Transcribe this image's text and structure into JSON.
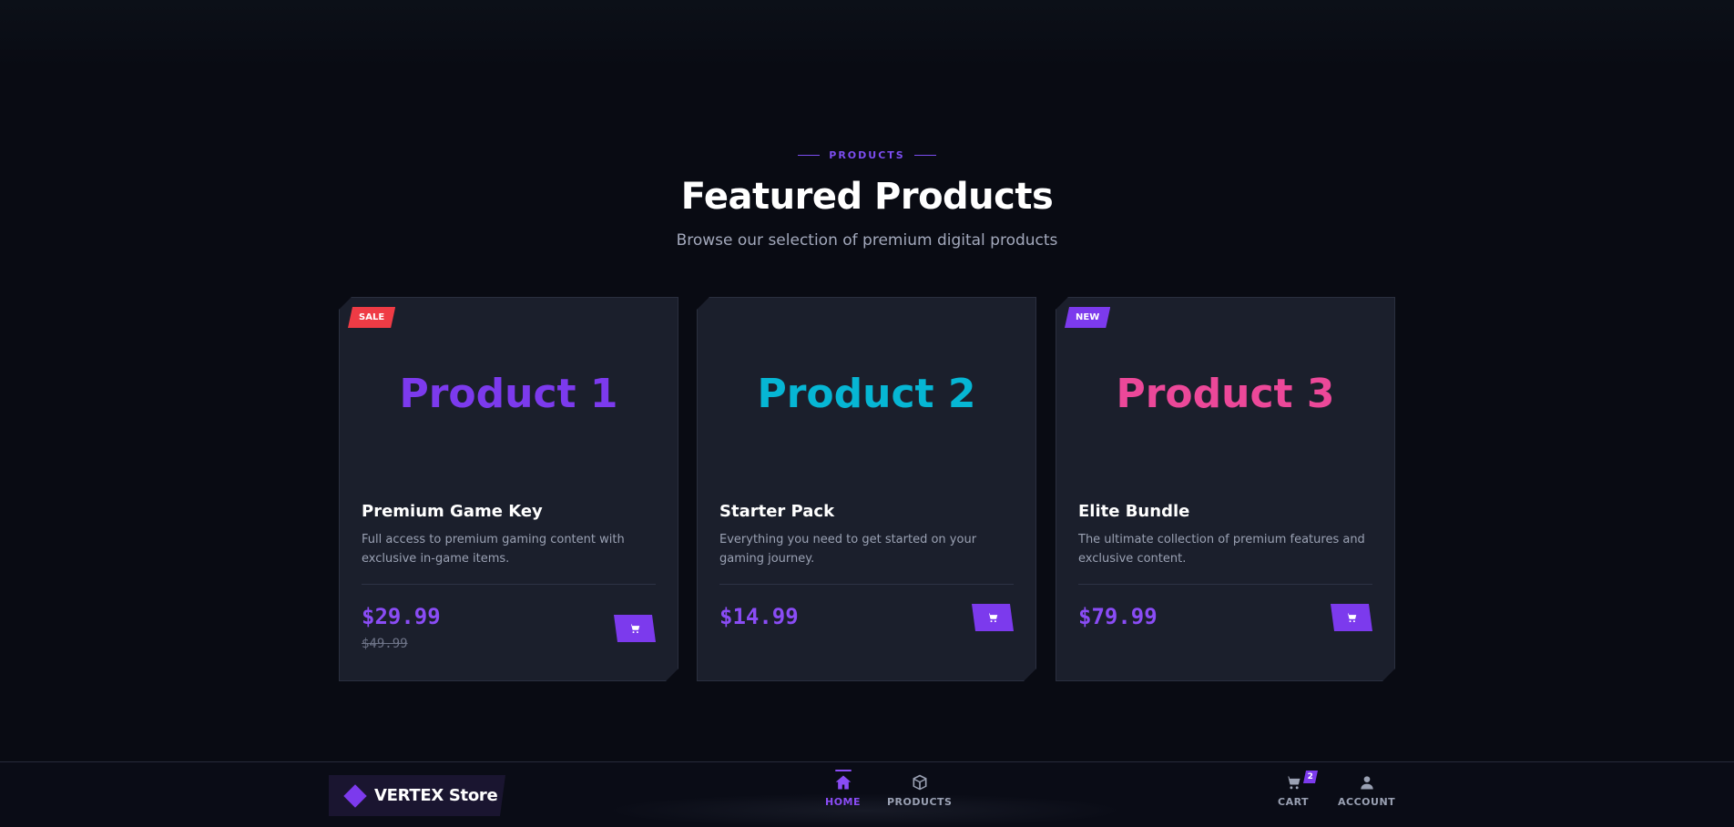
{
  "section": {
    "eyebrow": "PRODUCTS",
    "title": "Featured Products",
    "subtitle": "Browse our selection of premium digital products"
  },
  "products": [
    {
      "badge": "SALE",
      "hero": "Product 1",
      "hero_color": "#7c3aed",
      "name": "Premium Game Key",
      "description": "Full access to premium gaming content with exclusive in-game items.",
      "price": "$29.99",
      "old_price": "$49.99",
      "cart_icon": "cart-icon"
    },
    {
      "badge": "",
      "hero": "Product 2",
      "hero_color": "#06b6d4",
      "name": "Starter Pack",
      "description": "Everything you need to get started on your gaming journey.",
      "price": "$14.99",
      "old_price": "",
      "cart_icon": "cart-icon"
    },
    {
      "badge": "NEW",
      "hero": "Product 3",
      "hero_color": "#ec4899",
      "name": "Elite Bundle",
      "description": "The ultimate collection of premium features and exclusive content.",
      "price": "$79.99",
      "old_price": "",
      "cart_icon": "cart-icon"
    }
  ],
  "nav": {
    "brand": "VERTEX Store",
    "home": "HOME",
    "products": "PRODUCTS",
    "cart": "CART",
    "cart_count": "2",
    "account": "ACCOUNT"
  },
  "colors": {
    "accent": "#7c3aed",
    "sale": "#ef3b45",
    "background": "#090b13",
    "card": "#1b1f2c"
  }
}
